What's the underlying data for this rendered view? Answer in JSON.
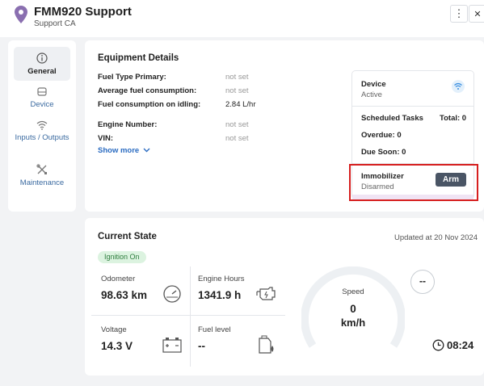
{
  "header": {
    "title": "FMM920 Support",
    "subtitle": "Support CA",
    "menu_icon": "⋮",
    "close_icon": "✕"
  },
  "sidebar": {
    "items": [
      {
        "label": "General",
        "icon": "info-circle"
      },
      {
        "label": "Device",
        "icon": "device"
      },
      {
        "label": "Inputs / Outputs",
        "icon": "wifi"
      },
      {
        "label": "Maintenance",
        "icon": "tools"
      }
    ]
  },
  "equipment": {
    "title": "Equipment Details",
    "rows": [
      {
        "label": "Fuel Type Primary:",
        "value": "not set"
      },
      {
        "label": "Average fuel consumption:",
        "value": "not set"
      },
      {
        "label": "Fuel consumption on idling:",
        "value": "2.84 L/hr"
      },
      {
        "label": "Engine Number:",
        "value": "not set"
      },
      {
        "label": "VIN:",
        "value": "not set"
      }
    ],
    "show_more": "Show more",
    "device_label": "Device",
    "device_status": "Active",
    "scheduled_tasks_label": "Scheduled Tasks",
    "total": "Total: 0",
    "overdue": "Overdue: 0",
    "due_soon": "Due Soon: 0",
    "immobilizer_label": "Immobilizer",
    "immobilizer_status": "Disarmed",
    "arm_label": "Arm"
  },
  "current_state": {
    "title": "Current State",
    "updated": "Updated at 20 Nov 2024",
    "ignition": "Ignition On",
    "odometer_label": "Odometer",
    "odometer_value": "98.63 km",
    "engine_hours_label": "Engine Hours",
    "engine_hours_value": "1341.9 h",
    "voltage_label": "Voltage",
    "voltage_value": "14.3 V",
    "fuel_label": "Fuel level",
    "fuel_value": "--",
    "speed_label": "Speed",
    "speed_value": "0",
    "speed_unit": "km/h",
    "direction_value": "--",
    "time_value": "08:24"
  },
  "colors": {
    "accent_blue": "#2a6bc1",
    "highlight_red": "#d61f1f",
    "arm_button": "#4a5565",
    "ignition_bg": "#dcf3e0",
    "pin_purple": "#8a6fb0"
  }
}
